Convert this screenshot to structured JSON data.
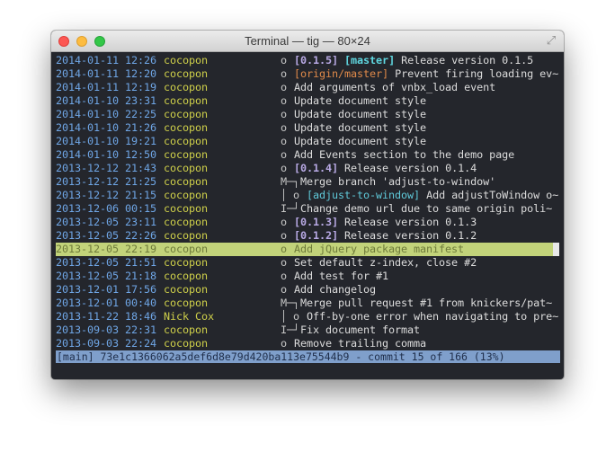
{
  "window": {
    "title": "Terminal — tig — 80×24"
  },
  "commits": [
    {
      "date": "2014-01-11 12:26",
      "author": "cocopon",
      "graph": "o",
      "refs": [
        {
          "text": "[0.1.5]",
          "kind": "tag"
        },
        {
          "text": "[master]",
          "kind": "master"
        }
      ],
      "subject": "Release version 0.1.5"
    },
    {
      "date": "2014-01-11 12:20",
      "author": "cocopon",
      "graph": "o",
      "refs": [
        {
          "text": "[origin/master]",
          "kind": "remote"
        }
      ],
      "subject": "Prevent firing loading ev~"
    },
    {
      "date": "2014-01-11 12:19",
      "author": "cocopon",
      "graph": "o",
      "refs": [],
      "subject": "Add arguments of vnbx_load event"
    },
    {
      "date": "2014-01-10 23:31",
      "author": "cocopon",
      "graph": "o",
      "refs": [],
      "subject": "Update document style"
    },
    {
      "date": "2014-01-10 22:25",
      "author": "cocopon",
      "graph": "o",
      "refs": [],
      "subject": "Update document style"
    },
    {
      "date": "2014-01-10 21:26",
      "author": "cocopon",
      "graph": "o",
      "refs": [],
      "subject": "Update document style"
    },
    {
      "date": "2014-01-10 19:21",
      "author": "cocopon",
      "graph": "o",
      "refs": [],
      "subject": "Update document style"
    },
    {
      "date": "2014-01-10 12:50",
      "author": "cocopon",
      "graph": "o",
      "refs": [],
      "subject": "Add Events section to the demo page"
    },
    {
      "date": "2013-12-12 21:43",
      "author": "cocopon",
      "graph": "o",
      "refs": [
        {
          "text": "[0.1.4]",
          "kind": "tag"
        }
      ],
      "subject": "Release version 0.1.4"
    },
    {
      "date": "2013-12-12 21:25",
      "author": "cocopon",
      "graph": "M─┐",
      "refs": [],
      "subject": "Merge branch 'adjust-to-window'",
      "indent": 1
    },
    {
      "date": "2013-12-12 21:15",
      "author": "cocopon",
      "graph": "│ o",
      "refs": [
        {
          "text": "[adjust-to-window]",
          "kind": "branch"
        }
      ],
      "subject": "Add adjustToWindow o~",
      "indent": 2
    },
    {
      "date": "2013-12-06 00:15",
      "author": "cocopon",
      "graph": "I─┘",
      "refs": [],
      "subject": "Change demo url due to same origin poli~",
      "indent": 1
    },
    {
      "date": "2013-12-05 23:11",
      "author": "cocopon",
      "graph": "o",
      "refs": [
        {
          "text": "[0.1.3]",
          "kind": "tag"
        }
      ],
      "subject": "Release version 0.1.3"
    },
    {
      "date": "2013-12-05 22:26",
      "author": "cocopon",
      "graph": "o",
      "refs": [
        {
          "text": "[0.1.2]",
          "kind": "tag"
        }
      ],
      "subject": "Release version 0.1.2"
    },
    {
      "date": "2013-12-05 22:19",
      "author": "cocopon",
      "graph": "o",
      "refs": [],
      "subject": "Add jQuery package manifest",
      "selected": true
    },
    {
      "date": "2013-12-05 21:51",
      "author": "cocopon",
      "graph": "o",
      "refs": [],
      "subject": "Set default z-index, close #2"
    },
    {
      "date": "2013-12-05 21:18",
      "author": "cocopon",
      "graph": "o",
      "refs": [],
      "subject": "Add test for #1"
    },
    {
      "date": "2013-12-01 17:56",
      "author": "cocopon",
      "graph": "o",
      "refs": [],
      "subject": "Add changelog"
    },
    {
      "date": "2013-12-01 00:40",
      "author": "cocopon",
      "graph": "M─┐",
      "refs": [],
      "subject": "Merge pull request #1 from knickers/pat~",
      "indent": 1
    },
    {
      "date": "2013-11-22 18:46",
      "author": "Nick Cox",
      "graph": "│ o",
      "refs": [],
      "subject": "Off-by-one error when navigating to pre~",
      "indent": 2
    },
    {
      "date": "2013-09-03 22:31",
      "author": "cocopon",
      "graph": "I─┘",
      "refs": [],
      "subject": "Fix document format",
      "indent": 1
    },
    {
      "date": "2013-09-03 22:24",
      "author": "cocopon",
      "graph": "o",
      "refs": [],
      "subject": "Remove trailing comma"
    }
  ],
  "status_bar": "[main] 73e1c1366062a5def6d8e79d420ba113e75544b9 - commit 15 of 166 (13%)",
  "colors": {
    "date": "#6fa6e6",
    "author": "#cfd04a",
    "selected_row": "#c2d37a",
    "status_bar": "#7f9fcb",
    "terminal_bg": "#24262c"
  }
}
